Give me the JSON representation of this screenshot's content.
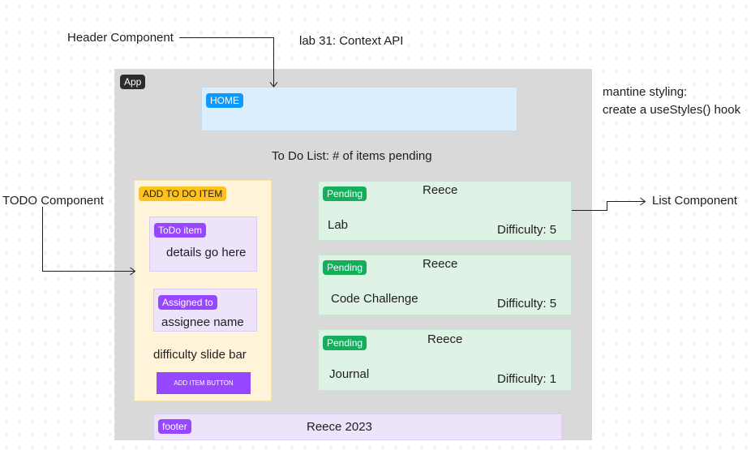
{
  "annotations": {
    "header_component": "Header Component",
    "lab_title": "lab 31: Context API",
    "mantine_line1": "mantine styling:",
    "mantine_line2": "create a useStyles() hook",
    "todo_component": "TODO Component",
    "list_component": "List Component"
  },
  "app": {
    "tag": "App",
    "header": {
      "tag": "HOME"
    },
    "heading": "To Do List: # of items pending",
    "todo_form": {
      "tag": "ADD TO DO ITEM",
      "todo_item": {
        "tag": "ToDo item",
        "text": "details go here"
      },
      "assigned": {
        "tag": "Assigned to",
        "text": "assignee name"
      },
      "difficulty": "difficulty slide bar",
      "button_label": "ADD ITEM BUTTON"
    },
    "list": [
      {
        "tag": "Pending",
        "assignee": "Reece",
        "task": "Lab",
        "difficulty": "Difficulty: 5"
      },
      {
        "tag": "Pending",
        "assignee": "Reece",
        "task": "Code Challenge",
        "difficulty": "Difficulty: 5"
      },
      {
        "tag": "Pending",
        "assignee": "Reece",
        "task": "Journal",
        "difficulty": "Difficulty: 1"
      }
    ],
    "footer": {
      "tag": "footer",
      "text": "Reece 2023"
    }
  },
  "colors": {
    "app_frame": "#d9d9d9",
    "app_tag": "#2c2c2c",
    "header_fill": "#daeefd",
    "header_tag": "#0d99ff",
    "todo_fill": "#fff4d9",
    "todo_tag": "#ffc21a",
    "purple_fill": "#ede3fb",
    "purple_tag": "#9747ff",
    "list_fill": "#dff2e6",
    "pending_tag": "#14ae5c"
  }
}
